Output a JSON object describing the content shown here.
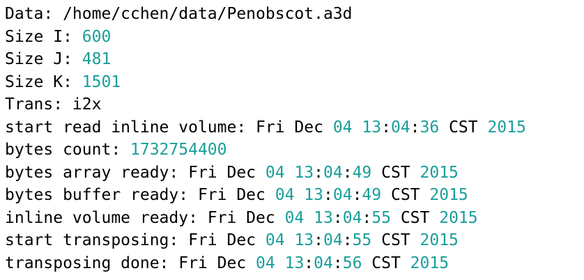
{
  "colors": {
    "text": "#000000",
    "number": "#1a9e9a",
    "background": "#ffffff"
  },
  "lines": [
    [
      {
        "t": "Data: /home/cchen/data/Penobscot.a3d",
        "n": false
      }
    ],
    [
      {
        "t": "Size I: ",
        "n": false
      },
      {
        "t": "600",
        "n": true
      }
    ],
    [
      {
        "t": "Size J: ",
        "n": false
      },
      {
        "t": "481",
        "n": true
      }
    ],
    [
      {
        "t": "Size K: ",
        "n": false
      },
      {
        "t": "1501",
        "n": true
      }
    ],
    [
      {
        "t": "Trans: i2x",
        "n": false
      }
    ],
    [
      {
        "t": "start read inline volume: Fri Dec ",
        "n": false
      },
      {
        "t": "04",
        "n": true
      },
      {
        "t": " ",
        "n": false
      },
      {
        "t": "13",
        "n": true
      },
      {
        "t": ":",
        "n": false
      },
      {
        "t": "04",
        "n": true
      },
      {
        "t": ":",
        "n": false
      },
      {
        "t": "36",
        "n": true
      },
      {
        "t": " CST ",
        "n": false
      },
      {
        "t": "2015",
        "n": true
      }
    ],
    [
      {
        "t": "bytes count: ",
        "n": false
      },
      {
        "t": "1732754400",
        "n": true
      }
    ],
    [
      {
        "t": "bytes array ready: Fri Dec ",
        "n": false
      },
      {
        "t": "04",
        "n": true
      },
      {
        "t": " ",
        "n": false
      },
      {
        "t": "13",
        "n": true
      },
      {
        "t": ":",
        "n": false
      },
      {
        "t": "04",
        "n": true
      },
      {
        "t": ":",
        "n": false
      },
      {
        "t": "49",
        "n": true
      },
      {
        "t": " CST ",
        "n": false
      },
      {
        "t": "2015",
        "n": true
      }
    ],
    [
      {
        "t": "bytes buffer ready: Fri Dec ",
        "n": false
      },
      {
        "t": "04",
        "n": true
      },
      {
        "t": " ",
        "n": false
      },
      {
        "t": "13",
        "n": true
      },
      {
        "t": ":",
        "n": false
      },
      {
        "t": "04",
        "n": true
      },
      {
        "t": ":",
        "n": false
      },
      {
        "t": "49",
        "n": true
      },
      {
        "t": " CST ",
        "n": false
      },
      {
        "t": "2015",
        "n": true
      }
    ],
    [
      {
        "t": "inline volume ready: Fri Dec ",
        "n": false
      },
      {
        "t": "04",
        "n": true
      },
      {
        "t": " ",
        "n": false
      },
      {
        "t": "13",
        "n": true
      },
      {
        "t": ":",
        "n": false
      },
      {
        "t": "04",
        "n": true
      },
      {
        "t": ":",
        "n": false
      },
      {
        "t": "55",
        "n": true
      },
      {
        "t": " CST ",
        "n": false
      },
      {
        "t": "2015",
        "n": true
      }
    ],
    [
      {
        "t": "start transposing: Fri Dec ",
        "n": false
      },
      {
        "t": "04",
        "n": true
      },
      {
        "t": " ",
        "n": false
      },
      {
        "t": "13",
        "n": true
      },
      {
        "t": ":",
        "n": false
      },
      {
        "t": "04",
        "n": true
      },
      {
        "t": ":",
        "n": false
      },
      {
        "t": "55",
        "n": true
      },
      {
        "t": " CST ",
        "n": false
      },
      {
        "t": "2015",
        "n": true
      }
    ],
    [
      {
        "t": "transposing done: Fri Dec ",
        "n": false
      },
      {
        "t": "04",
        "n": true
      },
      {
        "t": " ",
        "n": false
      },
      {
        "t": "13",
        "n": true
      },
      {
        "t": ":",
        "n": false
      },
      {
        "t": "04",
        "n": true
      },
      {
        "t": ":",
        "n": false
      },
      {
        "t": "56",
        "n": true
      },
      {
        "t": " CST ",
        "n": false
      },
      {
        "t": "2015",
        "n": true
      }
    ]
  ]
}
